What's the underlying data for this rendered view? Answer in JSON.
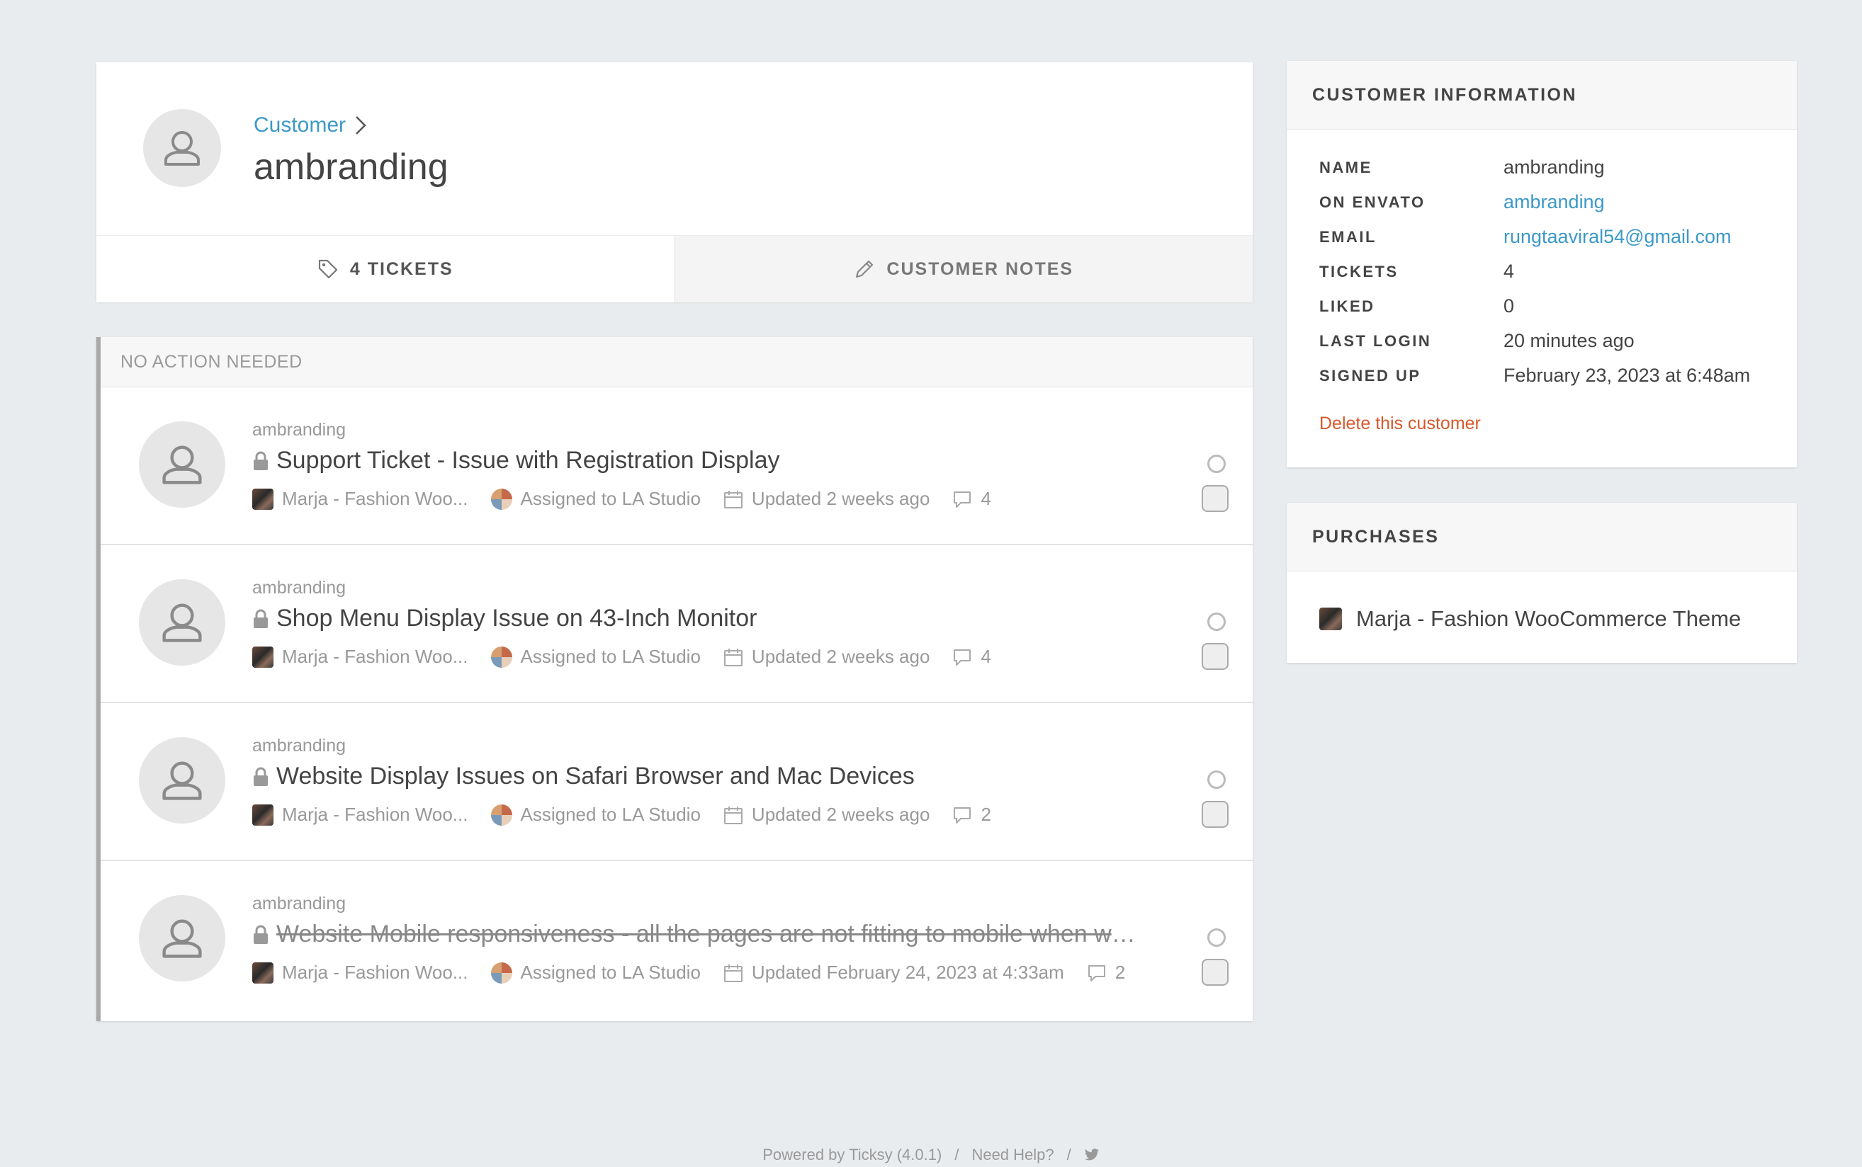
{
  "header": {
    "breadcrumb": "Customer",
    "title": "ambranding",
    "tabs": [
      {
        "label": "4 TICKETS",
        "icon": "tag-icon",
        "active": true
      },
      {
        "label": "CUSTOMER NOTES",
        "icon": "pencil-icon",
        "active": false
      }
    ]
  },
  "tickets": {
    "section_label": "NO ACTION NEEDED",
    "items": [
      {
        "user": "ambranding",
        "title": "Support Ticket - Issue with Registration Display",
        "product": "Marja - Fashion Woo...",
        "assigned": "Assigned to LA Studio",
        "updated": "Updated 2 weeks ago",
        "comments": "4",
        "closed": false
      },
      {
        "user": "ambranding",
        "title": "Shop Menu Display Issue on 43-Inch Monitor",
        "product": "Marja - Fashion Woo...",
        "assigned": "Assigned to LA Studio",
        "updated": "Updated 2 weeks ago",
        "comments": "4",
        "closed": false
      },
      {
        "user": "ambranding",
        "title": "Website Display Issues on Safari Browser and Mac Devices",
        "product": "Marja - Fashion Woo...",
        "assigned": "Assigned to LA Studio",
        "updated": "Updated 2 weeks ago",
        "comments": "2",
        "closed": false
      },
      {
        "user": "ambranding",
        "title": "Website Mobile responsiveness - all the pages are not fitting to mobile when we ...",
        "product": "Marja - Fashion Woo...",
        "assigned": "Assigned to LA Studio",
        "updated": "Updated February 24, 2023 at 4:33am",
        "comments": "2",
        "closed": true
      }
    ]
  },
  "customer_info": {
    "heading": "CUSTOMER INFORMATION",
    "rows": [
      {
        "label": "NAME",
        "value": "ambranding",
        "link": false
      },
      {
        "label": "ON ENVATO",
        "value": "ambranding",
        "link": true
      },
      {
        "label": "EMAIL",
        "value": "rungtaaviral54@gmail.com",
        "link": true
      },
      {
        "label": "TICKETS",
        "value": "4",
        "link": false
      },
      {
        "label": "LIKED",
        "value": "0",
        "link": false
      },
      {
        "label": "LAST LOGIN",
        "value": "20 minutes ago",
        "link": false
      },
      {
        "label": "SIGNED UP",
        "value": "February 23, 2023 at 6:48am",
        "link": false
      }
    ],
    "delete_label": "Delete this customer"
  },
  "purchases": {
    "heading": "PURCHASES",
    "items": [
      "Marja - Fashion WooCommerce Theme"
    ]
  },
  "footer": {
    "powered": "Powered by Ticksy (4.0.1)",
    "sep1": "/",
    "help": "Need Help?",
    "sep2": "/"
  },
  "colors": {
    "background": "#e9ecef",
    "link": "#3c99c8",
    "danger": "#d9582b"
  }
}
